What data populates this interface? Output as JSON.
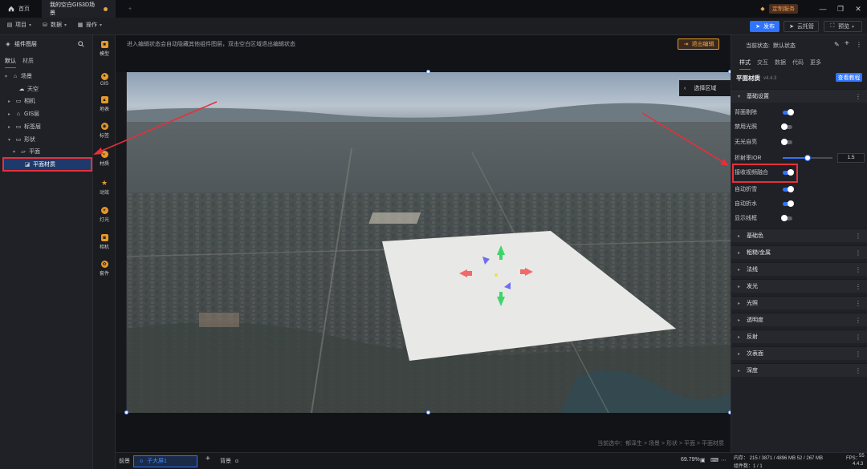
{
  "titlebar": {
    "tabs": [
      {
        "label": "首页",
        "icon": "home-icon"
      },
      {
        "label": "我的空白GIS3D场景",
        "modified": true
      }
    ],
    "new_tab": "+",
    "custom_service": "定制服务"
  },
  "toolbar": {
    "project": "项目",
    "data": "数据",
    "operation": "操作",
    "publish": "发布",
    "cloud_host": "云托管",
    "preview": "预览"
  },
  "left_panel": {
    "title": "组件图层",
    "subtabs": [
      "默认",
      "材质"
    ],
    "tree": [
      {
        "label": "场景",
        "icon": "scene-icon",
        "caret": "▾",
        "depth": 0
      },
      {
        "label": "天空",
        "icon": "sky-icon",
        "caret": "",
        "depth": 1
      },
      {
        "label": "相机",
        "icon": "folder-icon",
        "caret": "▸",
        "depth": 1
      },
      {
        "label": "GIS层",
        "icon": "gis-icon",
        "caret": "▸",
        "depth": 1
      },
      {
        "label": "标签层",
        "icon": "folder-icon",
        "caret": "▸",
        "depth": 1
      },
      {
        "label": "形状",
        "icon": "folder-icon",
        "caret": "▾",
        "depth": 1
      },
      {
        "label": "平面",
        "icon": "plane-icon",
        "caret": "▾",
        "depth": 2
      },
      {
        "label": "平面材质",
        "icon": "material-icon",
        "caret": "",
        "depth": 3,
        "selected": true
      }
    ]
  },
  "icon_bar": [
    {
      "label": "模型",
      "icon": "model-icon"
    },
    {
      "label": "GIS",
      "icon": "gis-globe-icon"
    },
    {
      "label": "地表",
      "icon": "terrain-icon"
    },
    {
      "label": "标签",
      "icon": "tag-icon"
    },
    {
      "label": "材质",
      "icon": "material-ball-icon"
    },
    {
      "label": "动效",
      "icon": "effect-icon"
    },
    {
      "label": "灯光",
      "icon": "light-icon"
    },
    {
      "label": "相机",
      "icon": "camera-icon"
    },
    {
      "label": "套件",
      "icon": "kit-icon"
    }
  ],
  "viewport": {
    "hint": "进入编辑状态会自动隐藏其他组件图层，双击空白区域退出编辑状态",
    "exit_edit": "退出编辑",
    "select_region": "选择区域",
    "breadcrumb": "当前选中：郁泽生 > 场景 > 形状 > 平面 > 平面材质"
  },
  "bottombar": {
    "items": [
      "前景",
      "子大屏1",
      "背景"
    ],
    "zoom": "69.79%"
  },
  "right_panel": {
    "state_label": "当前状态:",
    "state_value": "默认状态",
    "tabs": [
      "样式",
      "交互",
      "数据",
      "代码",
      "更多"
    ],
    "component_name": "平面材质",
    "version": "v4.4.3",
    "tutorial": "查看教程",
    "basic_section": "基础设置",
    "props": [
      {
        "label": "背面剔除",
        "type": "toggle",
        "on": true
      },
      {
        "label": "禁用光照",
        "type": "toggle",
        "on": false
      },
      {
        "label": "无光自亮",
        "type": "toggle",
        "on": false
      },
      {
        "label": "折射率IOR",
        "type": "slider",
        "value": "1.5",
        "fraction": 0.5
      },
      {
        "label": "接收视频融合",
        "type": "toggle",
        "on": true,
        "highlighted": true
      },
      {
        "label": "自动折雪",
        "type": "toggle",
        "on": true
      },
      {
        "label": "自动折水",
        "type": "toggle",
        "on": true
      },
      {
        "label": "显示线框",
        "type": "toggle",
        "on": false
      }
    ],
    "sections": [
      "基础色",
      "粗糙/金属",
      "法线",
      "发光",
      "光照",
      "透明度",
      "反射",
      "次表面",
      "深度"
    ]
  },
  "statusbar": {
    "memory": "内存： 215 / 3871 / 4896 MB  52 / 267 MB",
    "fps_label": "FPS：",
    "fps": "55",
    "components": "组件数：1 / 1",
    "version": "4.4.3"
  },
  "colors": {
    "accent": "#2f73ff",
    "warning": "#e59a2a",
    "annotation": "#e5303a"
  }
}
